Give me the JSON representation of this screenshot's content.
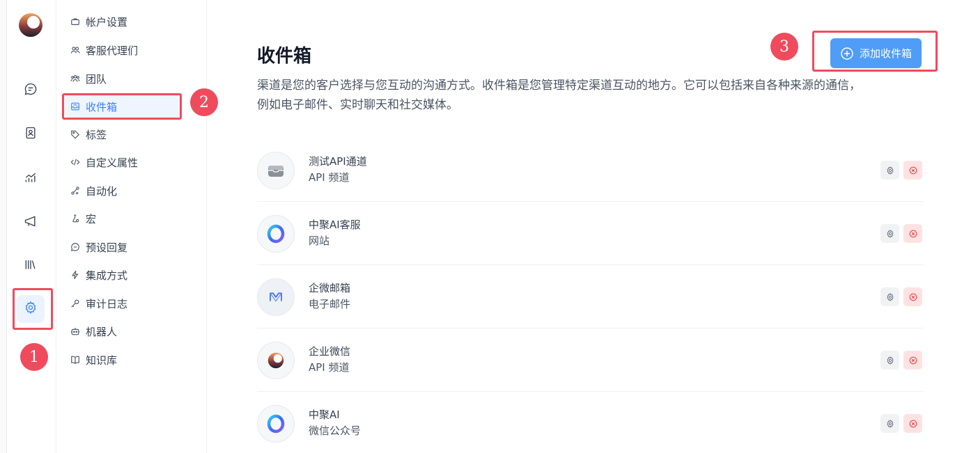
{
  "rail": {
    "items": [
      {
        "icon": "chat-icon"
      },
      {
        "icon": "contacts-icon"
      },
      {
        "icon": "reports-icon"
      },
      {
        "icon": "campaigns-icon"
      },
      {
        "icon": "library-icon"
      },
      {
        "icon": "gear-icon",
        "active": true
      }
    ]
  },
  "menu": {
    "items": [
      {
        "label": "帐户设置",
        "icon": "briefcase-icon"
      },
      {
        "label": "客服代理们",
        "icon": "people-icon"
      },
      {
        "label": "团队",
        "icon": "team-icon"
      },
      {
        "label": "收件箱",
        "icon": "mailbox-icon",
        "active": true
      },
      {
        "label": "标签",
        "icon": "tag-icon"
      },
      {
        "label": "自定义属性",
        "icon": "code-icon"
      },
      {
        "label": "自动化",
        "icon": "automation-icon"
      },
      {
        "label": "宏",
        "icon": "macro-icon"
      },
      {
        "label": "预设回复",
        "icon": "reply-icon"
      },
      {
        "label": "集成方式",
        "icon": "lightning-icon"
      },
      {
        "label": "审计日志",
        "icon": "key-icon"
      },
      {
        "label": "机器人",
        "icon": "bot-icon"
      },
      {
        "label": "知识库",
        "icon": "book-icon"
      }
    ]
  },
  "main": {
    "title": "收件箱",
    "description": "渠道是您的客户选择与您互动的沟通方式。收件箱是您管理特定渠道互动的地方。它可以包括来自各种来源的通信，例如电子邮件、实时聊天和社交媒体。",
    "add_button_label": "添加收件箱"
  },
  "inboxes": [
    {
      "name": "测试API通道",
      "type": "API 频道",
      "icon": "api-inbox-icon"
    },
    {
      "name": "中聚AI客服",
      "type": "网站",
      "icon": "website-ring-icon"
    },
    {
      "name": "企微邮箱",
      "type": "电子邮件",
      "icon": "email-m-icon"
    },
    {
      "name": "企业微信",
      "type": "API 频道",
      "icon": "brand-moon-icon"
    },
    {
      "name": "中聚AI",
      "type": "微信公众号",
      "icon": "website-ring-icon"
    }
  ],
  "annotations": [
    "1",
    "2",
    "3"
  ],
  "colors": {
    "accent": "#4f9df7",
    "annotation": "#ef4b5d",
    "delete": "#ef4444"
  }
}
